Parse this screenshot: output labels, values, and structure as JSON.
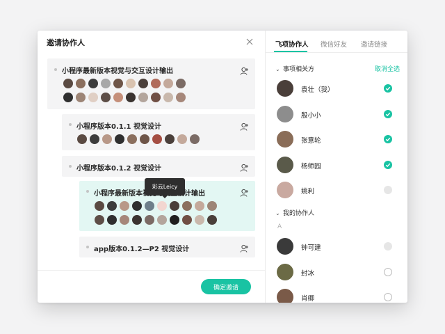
{
  "dialog": {
    "title": "邀请协作人",
    "confirm_label": "确定邀请"
  },
  "tasks": [
    {
      "title": "小程序最新版本视觉与交互设计输出",
      "avatars": [
        "#5a4a42",
        "#8b6f5e",
        "#3c3c3c",
        "#a8a8a8",
        "#6e5548",
        "#d9c3b0",
        "#4a3f3a",
        "#b06a5a",
        "#c4a99b",
        "#7b6b65",
        "#2f2f2f",
        "#9d8576",
        "#e0cfc4",
        "#5d4e47",
        "#c58f7a",
        "#3a3330",
        "#b3a59c",
        "#704f44",
        "#c9b8ac",
        "#a6877a"
      ]
    },
    {
      "title": "小程序版本0.1.1 视觉设计",
      "avatars": [
        "#5a4a42",
        "#3c3c3c",
        "#b89888",
        "#2f2f2f",
        "#8b6f5e",
        "#6e5548",
        "#a54e42",
        "#4a3f3a",
        "#c4a99b",
        "#7b6b65"
      ]
    },
    {
      "title": "小程序版本0.1.2 视觉设计",
      "avatars": []
    },
    {
      "title": "小程序最新版本视觉与交互设计输出",
      "avatars": [
        "#5a4a42",
        "#3c3c3c",
        "#b89888",
        "#2f2f2f",
        "#6e7f8a",
        "#f2d6d0",
        "#4a3f3a",
        "#8b6f5e",
        "#c4a99b",
        "#9d8576",
        "#5d4e47",
        "#2f2f2f",
        "#a6877a",
        "#3a3330",
        "#7b6b65",
        "#b3a59c",
        "#1f1f1f",
        "#704f44",
        "#c9b8ac",
        "#4a3f3a"
      ]
    },
    {
      "title": "app版本0.1.2—P2 视觉设计",
      "avatars": []
    }
  ],
  "tooltip": "彩云Leicy",
  "tabs": [
    "飞项协作人",
    "微信好友",
    "邀请链接"
  ],
  "right_panel": {
    "section1_label": "事项相关方",
    "deselect_all": "取消全选",
    "section2_label": "我的协作人",
    "letter": "A",
    "people1": [
      {
        "name": "袁壮（我）",
        "state": "on",
        "color": "#4a3f3a"
      },
      {
        "name": "殷小小",
        "state": "on",
        "color": "#8d8d8d"
      },
      {
        "name": "张意轮",
        "state": "on",
        "color": "#8a6d58"
      },
      {
        "name": "杨师园",
        "state": "on",
        "color": "#5a5a4a"
      },
      {
        "name": "姚利",
        "state": "dis",
        "color": "#c9a9a0"
      }
    ],
    "people2": [
      {
        "name": "钟可建",
        "state": "dis",
        "color": "#3a3a3a"
      },
      {
        "name": "封冰",
        "state": "off",
        "color": "#6b6a45"
      },
      {
        "name": "肖卿",
        "state": "off",
        "color": "#7a5a48"
      }
    ]
  },
  "colors": {
    "accent": "#19c3a3"
  }
}
